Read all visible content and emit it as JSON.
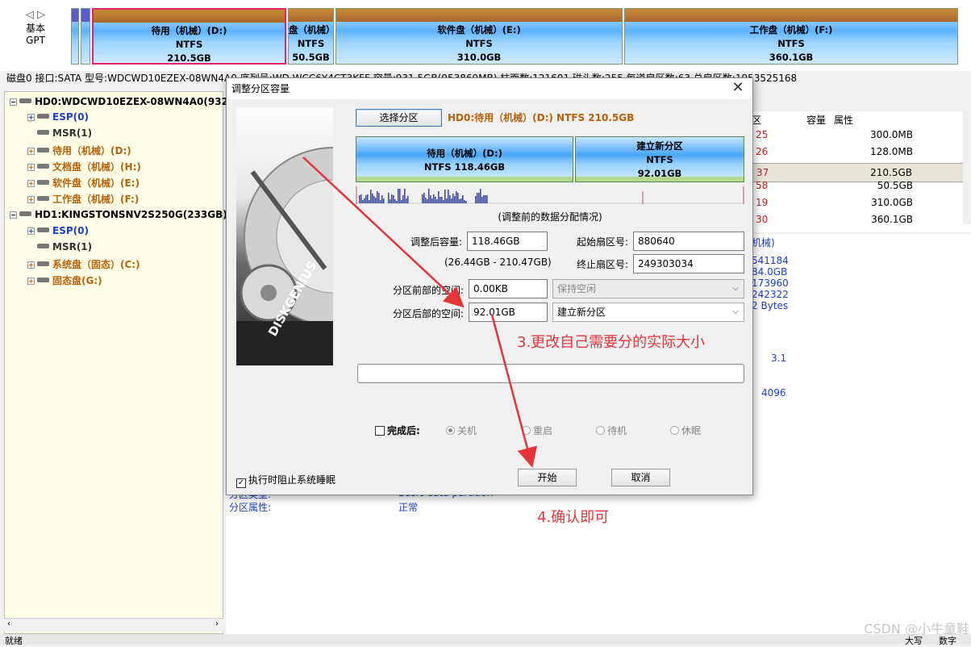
{
  "nav": {
    "line1": "基本",
    "line2": "GPT"
  },
  "disk_partitions": [
    {
      "name": "待用（机械）(D:)",
      "fs": "NTFS",
      "size": "210.5GB"
    },
    {
      "name": "盘（机械）",
      "fs": "NTFS",
      "size": "50.5GB"
    },
    {
      "name": "软件盘（机械）(E:)",
      "fs": "NTFS",
      "size": "310.0GB"
    },
    {
      "name": "工作盘（机械）(F:)",
      "fs": "NTFS",
      "size": "360.1GB"
    }
  ],
  "disk_info": "磁盘0 接口:SATA  型号:WDCWD10EZEX-08WN4A0  序列号:WD-WCC6Y4CT3KFF  容量:931.5GB(953869MB)  柱面数:121601  磁头数:255  每道扇区数:63  总扇区数:1953525168",
  "tree": {
    "disk0": "HD0:WDCWD10EZEX-08WN4A0(932(",
    "disk0_parts": [
      "ESP(0)",
      "MSR(1)",
      "待用（机械）(D:)",
      "文档盘（机械）(H:)",
      "软件盘（机械）(E:)",
      "工作盘（机械）(F:)"
    ],
    "disk1": "HD1:KINGSTONSNV2S250G(233GB)",
    "disk1_parts": [
      "ESP(0)",
      "MSR(1)",
      "系统盘（固态）(C:)",
      "固态盘(G:)"
    ]
  },
  "right_table": {
    "headers": [
      "区",
      "容量",
      "属性"
    ],
    "rows": [
      {
        "c1": "25",
        "size": "300.0MB"
      },
      {
        "c1": "26",
        "size": "128.0MB"
      },
      {
        "c1": "37",
        "size": "210.5GB"
      },
      {
        "c1": "58",
        "size": "50.5GB"
      },
      {
        "c1": "19",
        "size": "310.0GB"
      },
      {
        "c1": "30",
        "size": "360.1GB"
      }
    ]
  },
  "right_info": {
    "title": "机械)",
    "lines": [
      "541184",
      "84.0GB",
      "173960",
      "242322",
      "2 Bytes"
    ],
    "v1": "3.1",
    "v2": "4096"
  },
  "bottom_info": {
    "label1": "分区类型:",
    "label2": "分区属性:",
    "value1": "Basic data partition",
    "value2": "正常"
  },
  "status": {
    "left": "就绪",
    "right1": "大写",
    "right2": "数字"
  },
  "dialog": {
    "title": "调整分区容量",
    "close": "✕",
    "image_text": "DISKGENIUS",
    "pick_button": "选择分区",
    "pick_text": "HD0:待用（机械）(D:) NTFS 210.5GB",
    "new_parts": [
      {
        "line1": "待用（机械）(D:)",
        "line2": "NTFS 118.46GB",
        "line3": ""
      },
      {
        "line1": "建立新分区",
        "line2": "NTFS",
        "line3": "92.01GB"
      }
    ],
    "histo_caption": "(调整前的数据分配情况)",
    "label_new_size": "调整后容量:",
    "value_new_size": "118.46GB",
    "range": "(26.44GB - 210.47GB)",
    "label_start": "起始扇区号:",
    "value_start": "880640",
    "label_end": "终止扇区号:",
    "value_end": "249303034",
    "label_before": "分区前部的空间:",
    "value_before": "0.00KB",
    "select_before": "保持空闲",
    "label_after": "分区后部的空间:",
    "value_after": "92.01GB",
    "select_after": "建立新分区",
    "complete_label": "完成后:",
    "radios": [
      "关机",
      "重启",
      "待机",
      "休眠"
    ],
    "prevent_sleep": "执行时阻止系统睡眠",
    "start_button": "开始",
    "cancel_button": "取消"
  },
  "annotations": {
    "step3": "3.更改自己需要分的实际大小",
    "step4": "4.确认即可"
  },
  "watermark": "CSDN @小牛童鞋",
  "colors": {
    "accent": "#e5343a",
    "selected_border": "#e0246e",
    "tree_bg": "#ffffe8",
    "orange_text": "#b8610b",
    "blue_text": "#1a3fc8"
  }
}
